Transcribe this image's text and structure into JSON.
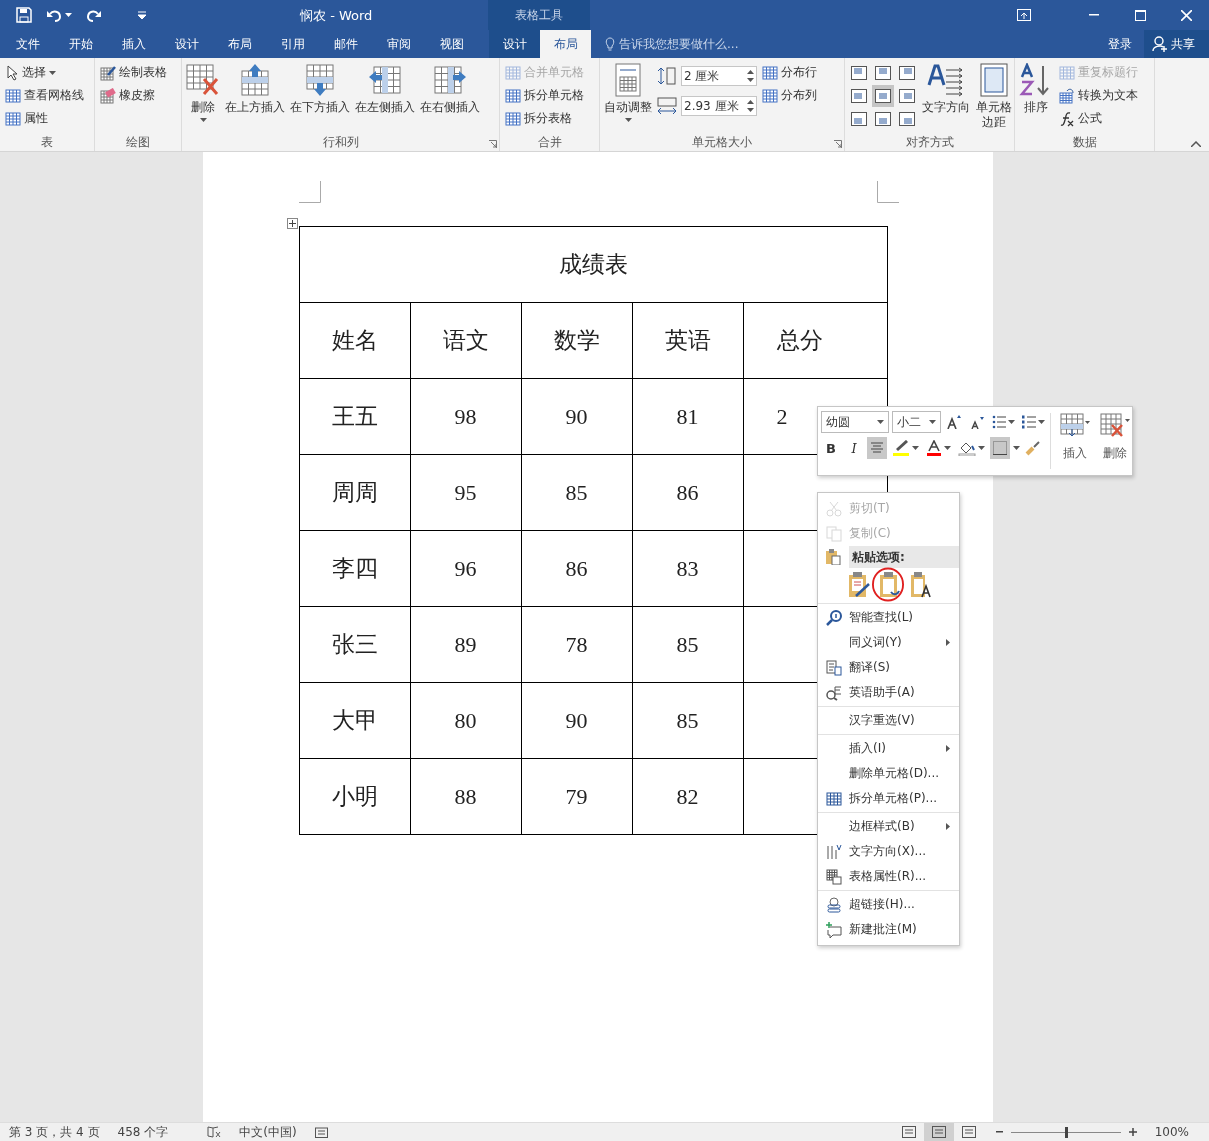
{
  "title_bar": {
    "title": "悯农 - Word",
    "context_title": "表格工具"
  },
  "tabs": [
    {
      "label": "文件",
      "selected": false
    },
    {
      "label": "开始",
      "selected": false
    },
    {
      "label": "插入",
      "selected": false
    },
    {
      "label": "设计",
      "selected": false
    },
    {
      "label": "布局",
      "selected": false
    },
    {
      "label": "引用",
      "selected": false
    },
    {
      "label": "邮件",
      "selected": false
    },
    {
      "label": "审阅",
      "selected": false
    },
    {
      "label": "视图",
      "selected": false
    }
  ],
  "context_tabs": [
    {
      "label": "设计",
      "selected": false
    },
    {
      "label": "布局",
      "selected": true
    }
  ],
  "tell_me": {
    "placeholder": "告诉我您想要做什么..."
  },
  "sign_in": "登录",
  "share": "共享",
  "ribbon": {
    "groups": [
      {
        "label": "表",
        "columns": [
          [
            {
              "kind": "small",
              "label": "选择",
              "dropdown": true,
              "disabled": false
            },
            {
              "kind": "small",
              "label": "查看网格线",
              "disabled": false
            },
            {
              "kind": "small",
              "label": "属性",
              "disabled": false
            }
          ]
        ]
      },
      {
        "label": "绘图",
        "columns": [
          [
            {
              "kind": "small",
              "label": "绘制表格",
              "disabled": false
            },
            {
              "kind": "small",
              "label": "橡皮擦",
              "disabled": false
            }
          ]
        ]
      },
      {
        "label": "行和列",
        "launcher": true,
        "columns": [
          [
            {
              "kind": "large",
              "label": "删除",
              "dropdown": true,
              "disabled": false
            }
          ],
          [
            {
              "kind": "large",
              "label": "在上方插入",
              "disabled": false
            }
          ],
          [
            {
              "kind": "large",
              "label": "在下方插入",
              "disabled": false
            }
          ],
          [
            {
              "kind": "large",
              "label": "在左侧插入",
              "disabled": false
            }
          ],
          [
            {
              "kind": "large",
              "label": "在右侧插入",
              "disabled": false
            }
          ]
        ]
      },
      {
        "label": "合并",
        "columns": [
          [
            {
              "kind": "small",
              "label": "合并单元格",
              "disabled": true
            },
            {
              "kind": "small",
              "label": "拆分单元格",
              "disabled": false
            },
            {
              "kind": "small",
              "label": "拆分表格",
              "disabled": false
            }
          ]
        ]
      },
      {
        "label": "单元格大小",
        "launcher": true,
        "columns": [
          [
            {
              "kind": "large",
              "label": "自动调整",
              "dropdown": true,
              "disabled": false
            }
          ],
          [
            {
              "kind": "spin",
              "value": "2 厘米"
            },
            {
              "kind": "spin",
              "value": "2.93 厘米"
            }
          ],
          [
            {
              "kind": "small",
              "label": "分布行",
              "disabled": false
            },
            {
              "kind": "small",
              "label": "分布列",
              "disabled": false
            }
          ]
        ]
      },
      {
        "label": "对齐方式",
        "columns": [
          [
            {
              "kind": "align_grid",
              "cells": [
                {
                  "selected": false
                },
                {
                  "selected": false
                },
                {
                  "selected": false
                },
                {
                  "selected": false
                },
                {
                  "selected": true
                },
                {
                  "selected": false
                },
                {
                  "selected": false
                },
                {
                  "selected": false
                },
                {
                  "selected": false
                }
              ]
            }
          ],
          [
            {
              "kind": "large",
              "label": "文字方向",
              "disabled": false
            }
          ],
          [
            {
              "kind": "large",
              "label": "单元格边距",
              "disabled": false
            }
          ]
        ]
      },
      {
        "label": "数据",
        "columns": [
          [
            {
              "kind": "large",
              "label": "排序",
              "disabled": false
            }
          ],
          [
            {
              "kind": "small",
              "label": "重复标题行",
              "disabled": true
            },
            {
              "kind": "small",
              "label": "转换为文本",
              "disabled": false
            },
            {
              "kind": "small",
              "label": "公式",
              "disabled": false
            }
          ]
        ]
      }
    ]
  },
  "table": {
    "title": "成绩表",
    "header": [
      "姓名",
      "语文",
      "数学",
      "英语",
      "总分"
    ],
    "rows": [
      [
        "王五",
        "98",
        "90",
        "81",
        "2"
      ],
      [
        "周周",
        "95",
        "85",
        "86"
      ],
      [
        "李四",
        "96",
        "86",
        "83"
      ],
      [
        "张三",
        "89",
        "78",
        "85"
      ],
      [
        "大甲",
        "80",
        "90",
        "85"
      ],
      [
        "小明",
        "88",
        "79",
        "82"
      ]
    ]
  },
  "mini_toolbar": {
    "font": "幼圆",
    "size": "小二",
    "bold": "B",
    "italic": "I",
    "align_center": {
      "selected": true
    },
    "borders": {
      "selected": true
    },
    "insert": "插入",
    "delete": "删除"
  },
  "context_menu": {
    "groups": [
      [
        {
          "kind": "item",
          "label": "剪切(T)",
          "disabled": true,
          "submenu": false
        },
        {
          "kind": "item",
          "label": "复制(C)",
          "disabled": true,
          "submenu": false
        },
        {
          "kind": "header",
          "label": "粘贴选项:"
        },
        {
          "kind": "paste_options"
        }
      ],
      [
        {
          "kind": "item",
          "label": "智能查找(L)",
          "disabled": false,
          "submenu": false
        },
        {
          "kind": "item",
          "label": "同义词(Y)",
          "disabled": false,
          "submenu": true
        },
        {
          "kind": "item",
          "label": "翻译(S)",
          "disabled": false,
          "submenu": false
        },
        {
          "kind": "item",
          "label": "英语助手(A)",
          "disabled": false,
          "submenu": false
        }
      ],
      [
        {
          "kind": "item",
          "label": "汉字重选(V)",
          "disabled": false,
          "submenu": false
        }
      ],
      [
        {
          "kind": "item",
          "label": "插入(I)",
          "disabled": false,
          "submenu": true
        },
        {
          "kind": "item",
          "label": "删除单元格(D)...",
          "disabled": false,
          "submenu": false
        },
        {
          "kind": "item",
          "label": "拆分单元格(P)...",
          "disabled": false,
          "submenu": false
        }
      ],
      [
        {
          "kind": "item",
          "label": "边框样式(B)",
          "disabled": false,
          "submenu": true
        },
        {
          "kind": "item",
          "label": "文字方向(X)...",
          "disabled": false,
          "submenu": false
        },
        {
          "kind": "item",
          "label": "表格属性(R)...",
          "disabled": false,
          "submenu": false
        }
      ],
      [
        {
          "kind": "item",
          "label": "超链接(H)...",
          "disabled": false,
          "submenu": false
        },
        {
          "kind": "item",
          "label": "新建批注(M)",
          "disabled": false,
          "submenu": false
        }
      ]
    ]
  },
  "status_bar": {
    "page": "第 3 页，共 4 页",
    "words": "458 个字",
    "language": "中文(中国)",
    "views": [
      {
        "selected": false
      },
      {
        "selected": true
      },
      {
        "selected": false
      }
    ],
    "zoom": {
      "level": 0.5
    },
    "zoom_percent": "100%"
  }
}
